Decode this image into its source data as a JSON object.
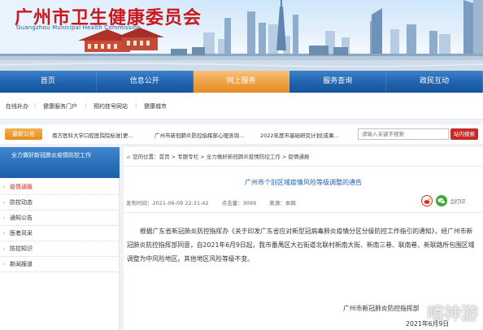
{
  "header": {
    "title": "广州市卫生健康委员会",
    "subtitle": "Guangzhou Municipal Health Commission"
  },
  "nav": {
    "items": [
      "首页",
      "信息公开",
      "网上服务",
      "服务查询",
      "政民互动"
    ],
    "active": "网上服务"
  },
  "sublinks": [
    "在线补办",
    "健康服务门户",
    "预约挂号网站",
    "健康城市"
  ],
  "notice": {
    "badge": "最新公告",
    "items": [
      "南方医科大学口腔医院院标准[更…",
      "广州市新冠肺炎防控指挥部心理咨询…",
      "2022年度市基础研究计划[成果…"
    ],
    "search_placeholder": "请输入关键字搜索",
    "search_button": "站内搜索"
  },
  "sidebar": {
    "heading": "全力做好新冠肺炎疫情防控工作",
    "items": [
      "疫情通报",
      "防控动态",
      "通知公告",
      "医者风采",
      "防控知识",
      "新闻报道"
    ],
    "active_index": 0
  },
  "breadcrumb": [
    "首页",
    "专题专栏",
    "全力做好新冠肺炎疫情防控工作",
    "疫情通报"
  ],
  "breadcrumb_prefix": "您的位置：",
  "breadcrumb_sep": " > ",
  "article": {
    "title": "广州市个别区域疫情风险等级调整的通告",
    "publish_time": "发布时间：2021-06-09 22:31:42",
    "views": "点击量：3099",
    "source": "来源：本网",
    "print_label": "打印",
    "body": "根据广东省新冠肺炎防控指挥办《关于印发广东省应对新型冠病毒肺炎疫情分区分级防控工作指引的通知》，经广州市新冠肺炎防控指挥部同意，自2021年6月9日起，我市番禺区大石街道北联村新南大街、新南三巷、联南巷、新联路所包围区域调整为中风险地区。其他地区风险等级不变。",
    "signature": "广州市新冠肺炎防控指挥部",
    "date": "2021年6月9日"
  },
  "watermark": "嘻神游",
  "colors": {
    "brand_red": "#c9191e",
    "nav_blue": "#1f62ad",
    "nav_active_orange": "#ee9d3e",
    "title_blue": "#1f5fa9"
  }
}
